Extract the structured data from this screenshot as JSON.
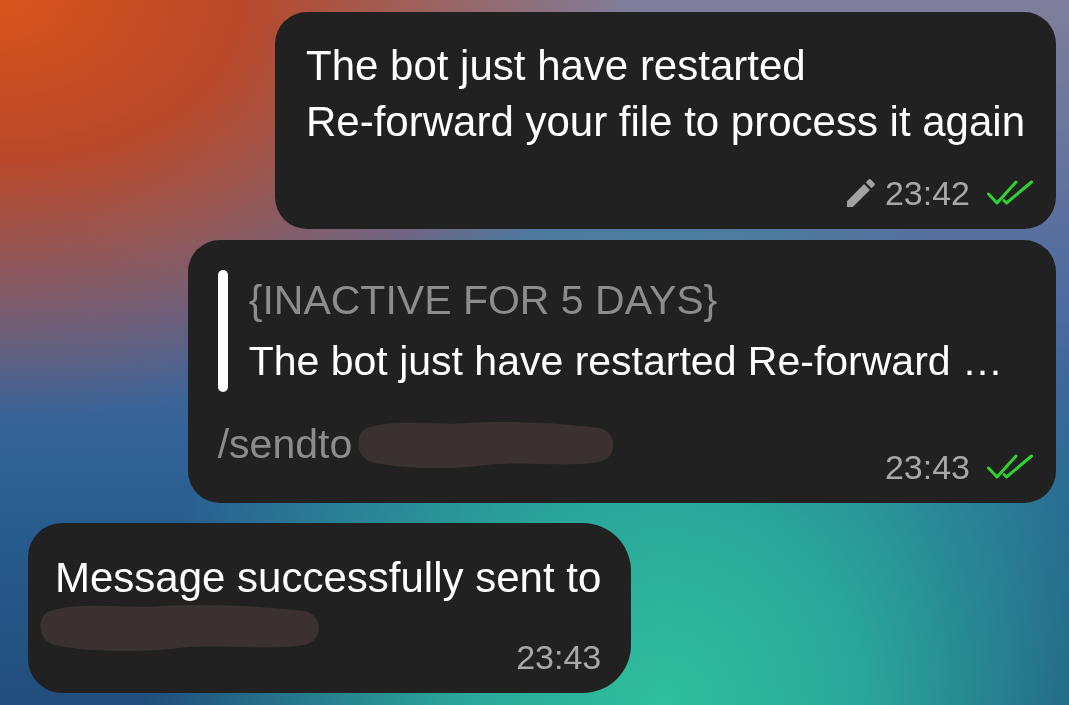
{
  "messages": [
    {
      "kind": "outgoing",
      "text": "The bot just have restarted\nRe-forward your file to process it again",
      "edited": true,
      "time": "23:42",
      "read": true
    },
    {
      "kind": "outgoing",
      "reply": {
        "title": "{INACTIVE FOR 5 DAYS}",
        "text": "The bot just have restarted Re-forward …"
      },
      "command": "/sendto",
      "recipient_redacted": true,
      "time": "23:43",
      "read": true
    },
    {
      "kind": "incoming",
      "text": "Message successfully sent to",
      "recipient_redacted": true,
      "time": "23:43"
    }
  ]
}
